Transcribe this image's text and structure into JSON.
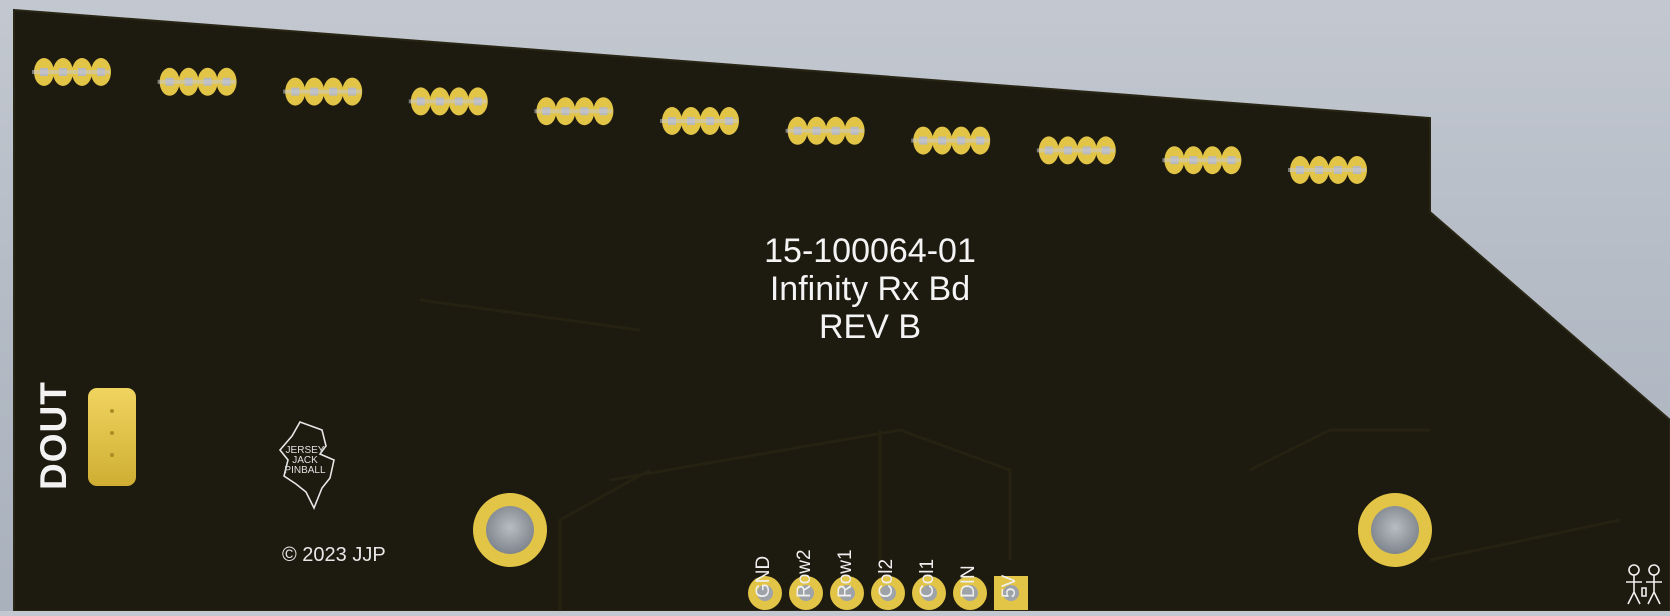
{
  "board": {
    "part_number": "15-100064-01",
    "name": "Infinity Rx Bd",
    "revision": "REV B",
    "connector_label": "DOUT",
    "copyright": "© 2023 JJP",
    "logo_text": [
      "JERSEY",
      "JACK",
      "PINBALL"
    ],
    "header_pins": [
      "GND",
      "Row2",
      "Row1",
      "Col2",
      "Col1",
      "DIN",
      "5V"
    ],
    "led_footprint_count": 11,
    "colors": {
      "board": "#1d1a0e",
      "pad_gold": "#e2c447",
      "silkscreen": "#f2f2f2",
      "background": "#b8bfc9"
    },
    "icons": [
      "mounting-hole-icon",
      "people-icon"
    ]
  }
}
